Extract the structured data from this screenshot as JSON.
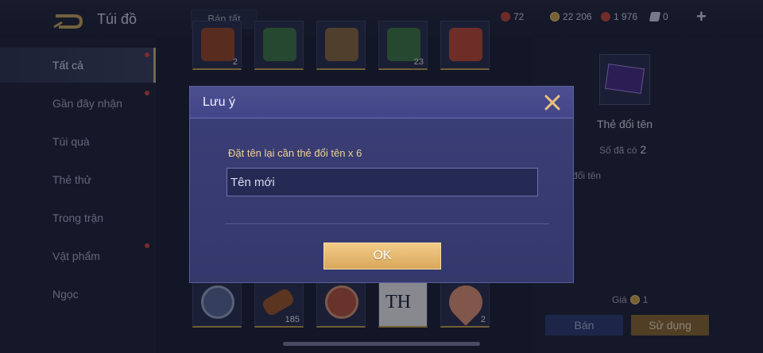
{
  "header": {
    "title": "Túi đồ",
    "sell_all_label": "Bán tất",
    "currencies": [
      {
        "icon": "red-gem-icon",
        "value": "72",
        "color": "#c2463c"
      },
      {
        "icon": "gold-coin-icon",
        "value": "22 206",
        "color": "#d1a84a"
      },
      {
        "icon": "ruby-icon",
        "value": "1 976",
        "color": "#c64a3a"
      },
      {
        "icon": "voucher-icon",
        "value": "0",
        "color": "#cfd5ea"
      }
    ],
    "plus_label": "+"
  },
  "sidebar": {
    "items": [
      {
        "label": "Tất cả",
        "active": true,
        "dot": true
      },
      {
        "label": "Gần đây nhận",
        "active": false,
        "dot": true
      },
      {
        "label": "Túi quà",
        "active": false,
        "dot": false
      },
      {
        "label": "Thẻ thử",
        "active": false,
        "dot": false
      },
      {
        "label": "Trong trận",
        "active": false,
        "dot": false
      },
      {
        "label": "Vật phẩm",
        "active": false,
        "dot": true
      },
      {
        "label": "Ngọc",
        "active": false,
        "dot": false
      }
    ]
  },
  "grid": {
    "top_row_counts": [
      "2",
      "",
      "",
      "23",
      ""
    ],
    "bottom_row": [
      {
        "icon": "rr2-badge-icon",
        "count": ""
      },
      {
        "icon": "horn-icon",
        "count": "185"
      },
      {
        "icon": "rr1-badge-icon",
        "count": ""
      },
      {
        "icon": "th-card-icon",
        "count": "",
        "label": "TH"
      },
      {
        "icon": "petal-icon",
        "count": "2"
      }
    ]
  },
  "detail": {
    "item_name": "Thẻ đổi tên",
    "owned_label": "Số đã có",
    "owned_value": "2",
    "description": "đổi tên",
    "price_label": "Giá",
    "price_value": "1",
    "sell_label": "Bán",
    "use_label": "Sử dụng"
  },
  "modal": {
    "title": "Lưu ý",
    "message": "Đặt tên lại cần thẻ đổi tên x 6",
    "input_placeholder": "Tên mới",
    "ok_label": "OK"
  },
  "colors": {
    "accent_gold": "#d9a75a",
    "modal_bg": "#3b3f78",
    "notice_text": "#f0d28f",
    "badge_red": "#d9463e"
  }
}
